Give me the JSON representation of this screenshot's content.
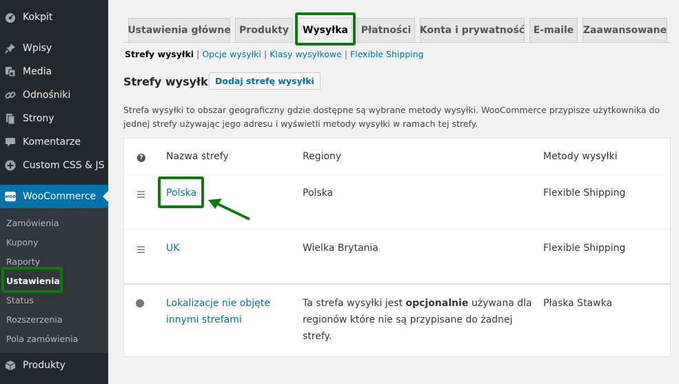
{
  "sidebar": {
    "items": [
      {
        "label": "Kokpit",
        "icon": "dashboard-icon"
      },
      {
        "label": "Wpisy",
        "icon": "pin-icon"
      },
      {
        "label": "Media",
        "icon": "media-icon"
      },
      {
        "label": "Odnośniki",
        "icon": "link-icon"
      },
      {
        "label": "Strony",
        "icon": "pages-icon"
      },
      {
        "label": "Komentarze",
        "icon": "comment-icon"
      },
      {
        "label": "Custom CSS & JS",
        "icon": "plus-circle-icon"
      },
      {
        "label": "WooCommerce",
        "icon": "woo-icon",
        "badge": "woo"
      },
      {
        "label": "Produkty",
        "icon": "box-icon"
      }
    ],
    "submenu": [
      {
        "label": "Zamówienia"
      },
      {
        "label": "Kupony"
      },
      {
        "label": "Raporty"
      },
      {
        "label": "Ustawienia",
        "current": true
      },
      {
        "label": "Status"
      },
      {
        "label": "Rozszerzenia"
      },
      {
        "label": "Pola zamówienia"
      }
    ]
  },
  "tabs": [
    {
      "label": "Ustawienia główne"
    },
    {
      "label": "Produkty"
    },
    {
      "label": "Wysyłka",
      "active": true
    },
    {
      "label": "Płatności"
    },
    {
      "label": "Konta i prywatność"
    },
    {
      "label": "E-maile"
    },
    {
      "label": "Zaawansowane"
    }
  ],
  "subnav": {
    "current": "Strefy wysyłki",
    "links": [
      "Opcje wysyłki",
      "Klasy wysyłkowe",
      "Flexible Shipping"
    ],
    "separator": "|"
  },
  "page": {
    "title": "Strefy wysyłki",
    "add_button": "Dodaj strefę wysyłki",
    "description": "Strefa wysyłki to obszar geograficzny gdzie dostępne są wybrane metody wysyłki. WooCommerce przypisze użytkownika do jednej strefy używając jego adresu i wyświetli metody wysyłki w ramach tej strefy."
  },
  "table": {
    "headers": {
      "help": "?",
      "name": "Nazwa strefy",
      "regions": "Regiony",
      "methods": "Metody wysyłki"
    },
    "rows": [
      {
        "name": "Polska",
        "regions": "Polska",
        "methods": "Flexible Shipping"
      },
      {
        "name": "UK",
        "regions": "Wielka Brytania",
        "methods": "Flexible Shipping"
      }
    ],
    "other": {
      "name_line1": "Lokalizacje nie objęte",
      "name_line2": "innymi strefami",
      "regions_pre": "Ta strefa wysyłki jest ",
      "regions_bold": "opcjonalnie",
      "regions_post1": " używana dla",
      "regions_line2": "regionów które nie są przypisane do żadnej strefy.",
      "methods": "Płaska Stawka"
    }
  },
  "colors": {
    "highlight": "#0e7a0e",
    "link": "#0073aa",
    "sidebar_bg": "#23282d",
    "active_menu": "#0073aa"
  }
}
